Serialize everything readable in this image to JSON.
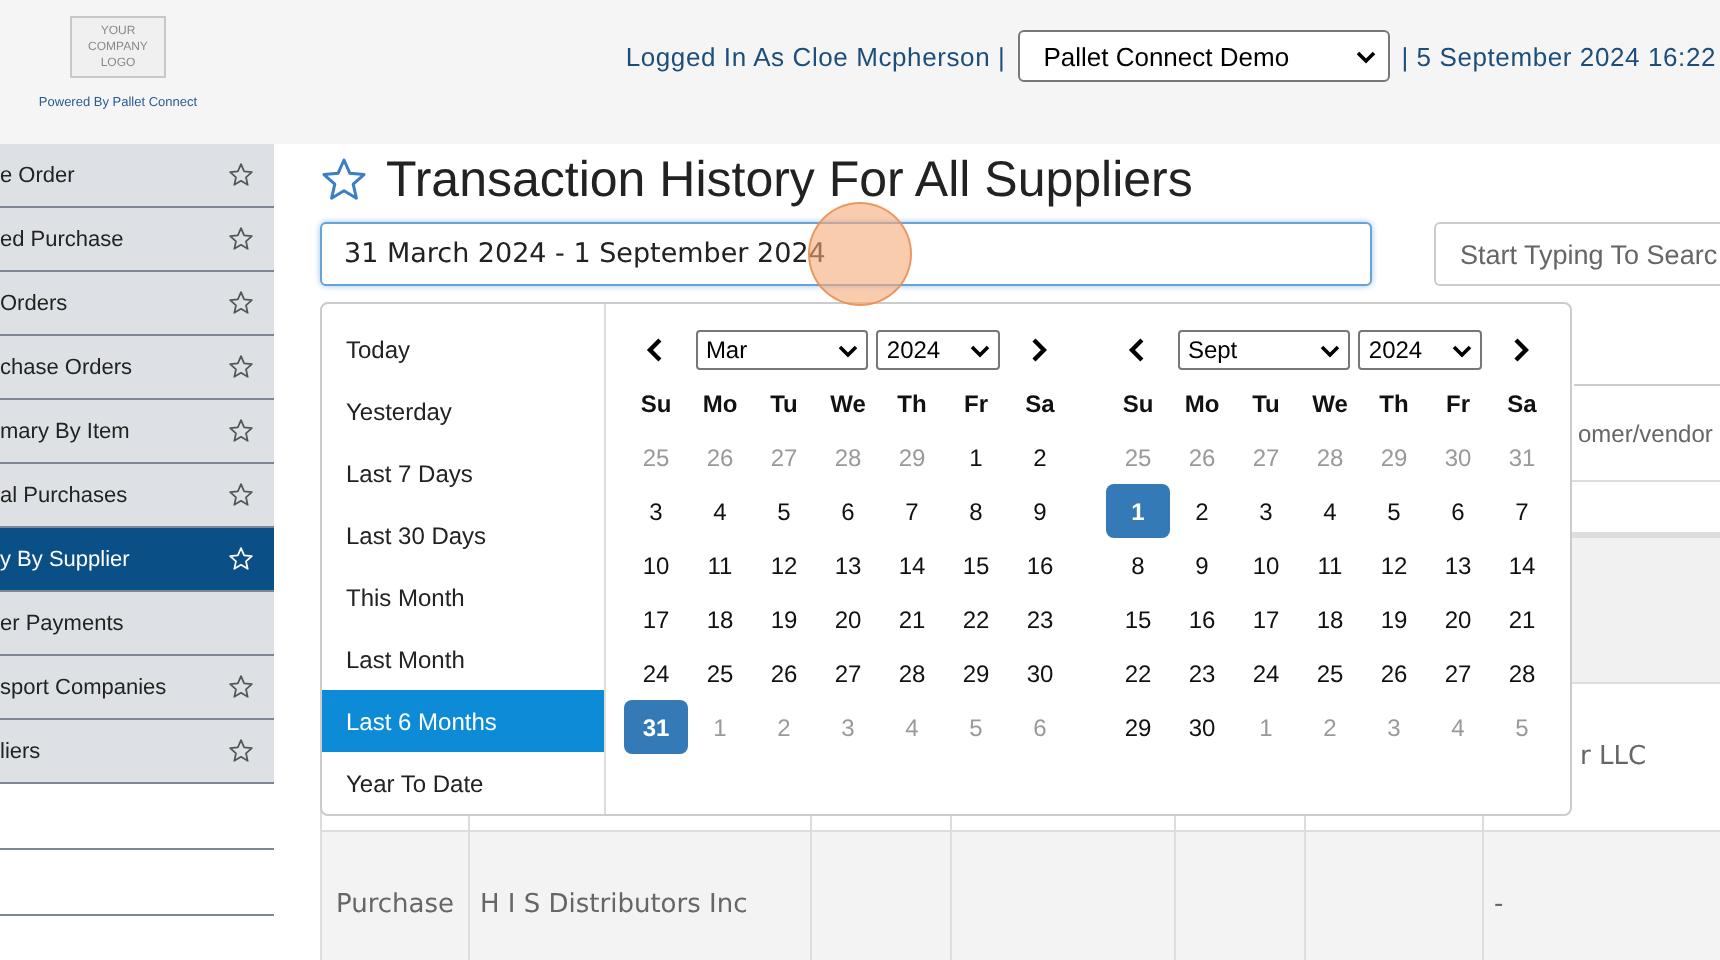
{
  "header": {
    "logo_lines": [
      "YOUR",
      "COMPANY",
      "LOGO"
    ],
    "powered_by": "Powered By Pallet Connect",
    "logged_in": "Logged In As Cloe Mcpherson |",
    "company_select": "Pallet Connect Demo",
    "datetime": "| 5 September 2024 16:22"
  },
  "sidebar": {
    "items": [
      {
        "label": "e Order",
        "starred": true,
        "selected": false
      },
      {
        "label": "ed Purchase",
        "starred": true,
        "selected": false
      },
      {
        "label": " Orders",
        "starred": true,
        "selected": false
      },
      {
        "label": "chase Orders",
        "starred": true,
        "selected": false
      },
      {
        "label": "mary By Item",
        "starred": true,
        "selected": false
      },
      {
        "label": "al Purchases",
        "starred": true,
        "selected": false
      },
      {
        "label": "y By Supplier",
        "starred": true,
        "selected": true
      },
      {
        "label": "er Payments",
        "starred": false,
        "selected": false
      },
      {
        "label": "sport Companies",
        "starred": true,
        "selected": false
      },
      {
        "label": "liers",
        "starred": true,
        "selected": false
      }
    ]
  },
  "page": {
    "title": "Transaction History For All Suppliers",
    "date_range": "31 March 2024 - 1 September 2024",
    "search": {
      "placeholder": "Start Typing To Searc"
    },
    "vendor_field": {
      "placeholder": "omer/vendor"
    }
  },
  "date_picker": {
    "ranges": [
      {
        "label": "Today",
        "selected": false
      },
      {
        "label": "Yesterday",
        "selected": false
      },
      {
        "label": "Last 7 Days",
        "selected": false
      },
      {
        "label": "Last 30 Days",
        "selected": false
      },
      {
        "label": "This Month",
        "selected": false
      },
      {
        "label": "Last Month",
        "selected": false
      },
      {
        "label": "Last 6 Months",
        "selected": true
      },
      {
        "label": "Year To Date",
        "selected": false
      }
    ],
    "calendars": [
      {
        "month": "Mar",
        "year": "2024",
        "weekdays": [
          "Su",
          "Mo",
          "Tu",
          "We",
          "Th",
          "Fr",
          "Sa"
        ],
        "weeks": [
          [
            {
              "label": "25",
              "outside": true,
              "selected": false
            },
            {
              "label": "26",
              "outside": true,
              "selected": false
            },
            {
              "label": "27",
              "outside": true,
              "selected": false
            },
            {
              "label": "28",
              "outside": true,
              "selected": false
            },
            {
              "label": "29",
              "outside": true,
              "selected": false
            },
            {
              "label": "1",
              "outside": false,
              "selected": false
            },
            {
              "label": "2",
              "outside": false,
              "selected": false
            }
          ],
          [
            {
              "label": "3",
              "outside": false,
              "selected": false
            },
            {
              "label": "4",
              "outside": false,
              "selected": false
            },
            {
              "label": "5",
              "outside": false,
              "selected": false
            },
            {
              "label": "6",
              "outside": false,
              "selected": false
            },
            {
              "label": "7",
              "outside": false,
              "selected": false
            },
            {
              "label": "8",
              "outside": false,
              "selected": false
            },
            {
              "label": "9",
              "outside": false,
              "selected": false
            }
          ],
          [
            {
              "label": "10",
              "outside": false,
              "selected": false
            },
            {
              "label": "11",
              "outside": false,
              "selected": false
            },
            {
              "label": "12",
              "outside": false,
              "selected": false
            },
            {
              "label": "13",
              "outside": false,
              "selected": false
            },
            {
              "label": "14",
              "outside": false,
              "selected": false
            },
            {
              "label": "15",
              "outside": false,
              "selected": false
            },
            {
              "label": "16",
              "outside": false,
              "selected": false
            }
          ],
          [
            {
              "label": "17",
              "outside": false,
              "selected": false
            },
            {
              "label": "18",
              "outside": false,
              "selected": false
            },
            {
              "label": "19",
              "outside": false,
              "selected": false
            },
            {
              "label": "20",
              "outside": false,
              "selected": false
            },
            {
              "label": "21",
              "outside": false,
              "selected": false
            },
            {
              "label": "22",
              "outside": false,
              "selected": false
            },
            {
              "label": "23",
              "outside": false,
              "selected": false
            }
          ],
          [
            {
              "label": "24",
              "outside": false,
              "selected": false
            },
            {
              "label": "25",
              "outside": false,
              "selected": false
            },
            {
              "label": "26",
              "outside": false,
              "selected": false
            },
            {
              "label": "27",
              "outside": false,
              "selected": false
            },
            {
              "label": "28",
              "outside": false,
              "selected": false
            },
            {
              "label": "29",
              "outside": false,
              "selected": false
            },
            {
              "label": "30",
              "outside": false,
              "selected": false
            }
          ],
          [
            {
              "label": "31",
              "outside": false,
              "selected": true
            },
            {
              "label": "1",
              "outside": true,
              "selected": false
            },
            {
              "label": "2",
              "outside": true,
              "selected": false
            },
            {
              "label": "3",
              "outside": true,
              "selected": false
            },
            {
              "label": "4",
              "outside": true,
              "selected": false
            },
            {
              "label": "5",
              "outside": true,
              "selected": false
            },
            {
              "label": "6",
              "outside": true,
              "selected": false
            }
          ]
        ]
      },
      {
        "month": "Sept",
        "year": "2024",
        "weekdays": [
          "Su",
          "Mo",
          "Tu",
          "We",
          "Th",
          "Fr",
          "Sa"
        ],
        "weeks": [
          [
            {
              "label": "25",
              "outside": true,
              "selected": false
            },
            {
              "label": "26",
              "outside": true,
              "selected": false
            },
            {
              "label": "27",
              "outside": true,
              "selected": false
            },
            {
              "label": "28",
              "outside": true,
              "selected": false
            },
            {
              "label": "29",
              "outside": true,
              "selected": false
            },
            {
              "label": "30",
              "outside": true,
              "selected": false
            },
            {
              "label": "31",
              "outside": true,
              "selected": false
            }
          ],
          [
            {
              "label": "1",
              "outside": false,
              "selected": true
            },
            {
              "label": "2",
              "outside": false,
              "selected": false
            },
            {
              "label": "3",
              "outside": false,
              "selected": false
            },
            {
              "label": "4",
              "outside": false,
              "selected": false
            },
            {
              "label": "5",
              "outside": false,
              "selected": false
            },
            {
              "label": "6",
              "outside": false,
              "selected": false
            },
            {
              "label": "7",
              "outside": false,
              "selected": false
            }
          ],
          [
            {
              "label": "8",
              "outside": false,
              "selected": false
            },
            {
              "label": "9",
              "outside": false,
              "selected": false
            },
            {
              "label": "10",
              "outside": false,
              "selected": false
            },
            {
              "label": "11",
              "outside": false,
              "selected": false
            },
            {
              "label": "12",
              "outside": false,
              "selected": false
            },
            {
              "label": "13",
              "outside": false,
              "selected": false
            },
            {
              "label": "14",
              "outside": false,
              "selected": false
            }
          ],
          [
            {
              "label": "15",
              "outside": false,
              "selected": false
            },
            {
              "label": "16",
              "outside": false,
              "selected": false
            },
            {
              "label": "17",
              "outside": false,
              "selected": false
            },
            {
              "label": "18",
              "outside": false,
              "selected": false
            },
            {
              "label": "19",
              "outside": false,
              "selected": false
            },
            {
              "label": "20",
              "outside": false,
              "selected": false
            },
            {
              "label": "21",
              "outside": false,
              "selected": false
            }
          ],
          [
            {
              "label": "22",
              "outside": false,
              "selected": false
            },
            {
              "label": "23",
              "outside": false,
              "selected": false
            },
            {
              "label": "24",
              "outside": false,
              "selected": false
            },
            {
              "label": "25",
              "outside": false,
              "selected": false
            },
            {
              "label": "26",
              "outside": false,
              "selected": false
            },
            {
              "label": "27",
              "outside": false,
              "selected": false
            },
            {
              "label": "28",
              "outside": false,
              "selected": false
            }
          ],
          [
            {
              "label": "29",
              "outside": false,
              "selected": false
            },
            {
              "label": "30",
              "outside": false,
              "selected": false
            },
            {
              "label": "1",
              "outside": true,
              "selected": false
            },
            {
              "label": "2",
              "outside": true,
              "selected": false
            },
            {
              "label": "3",
              "outside": true,
              "selected": false
            },
            {
              "label": "4",
              "outside": true,
              "selected": false
            },
            {
              "label": "5",
              "outside": true,
              "selected": false
            }
          ]
        ]
      }
    ]
  },
  "table": {
    "rows": [
      {
        "column_7": "r LLC"
      },
      {
        "column_1": "Purchase",
        "column_2": "H I S Distributors Inc",
        "column_7": "-"
      }
    ]
  }
}
